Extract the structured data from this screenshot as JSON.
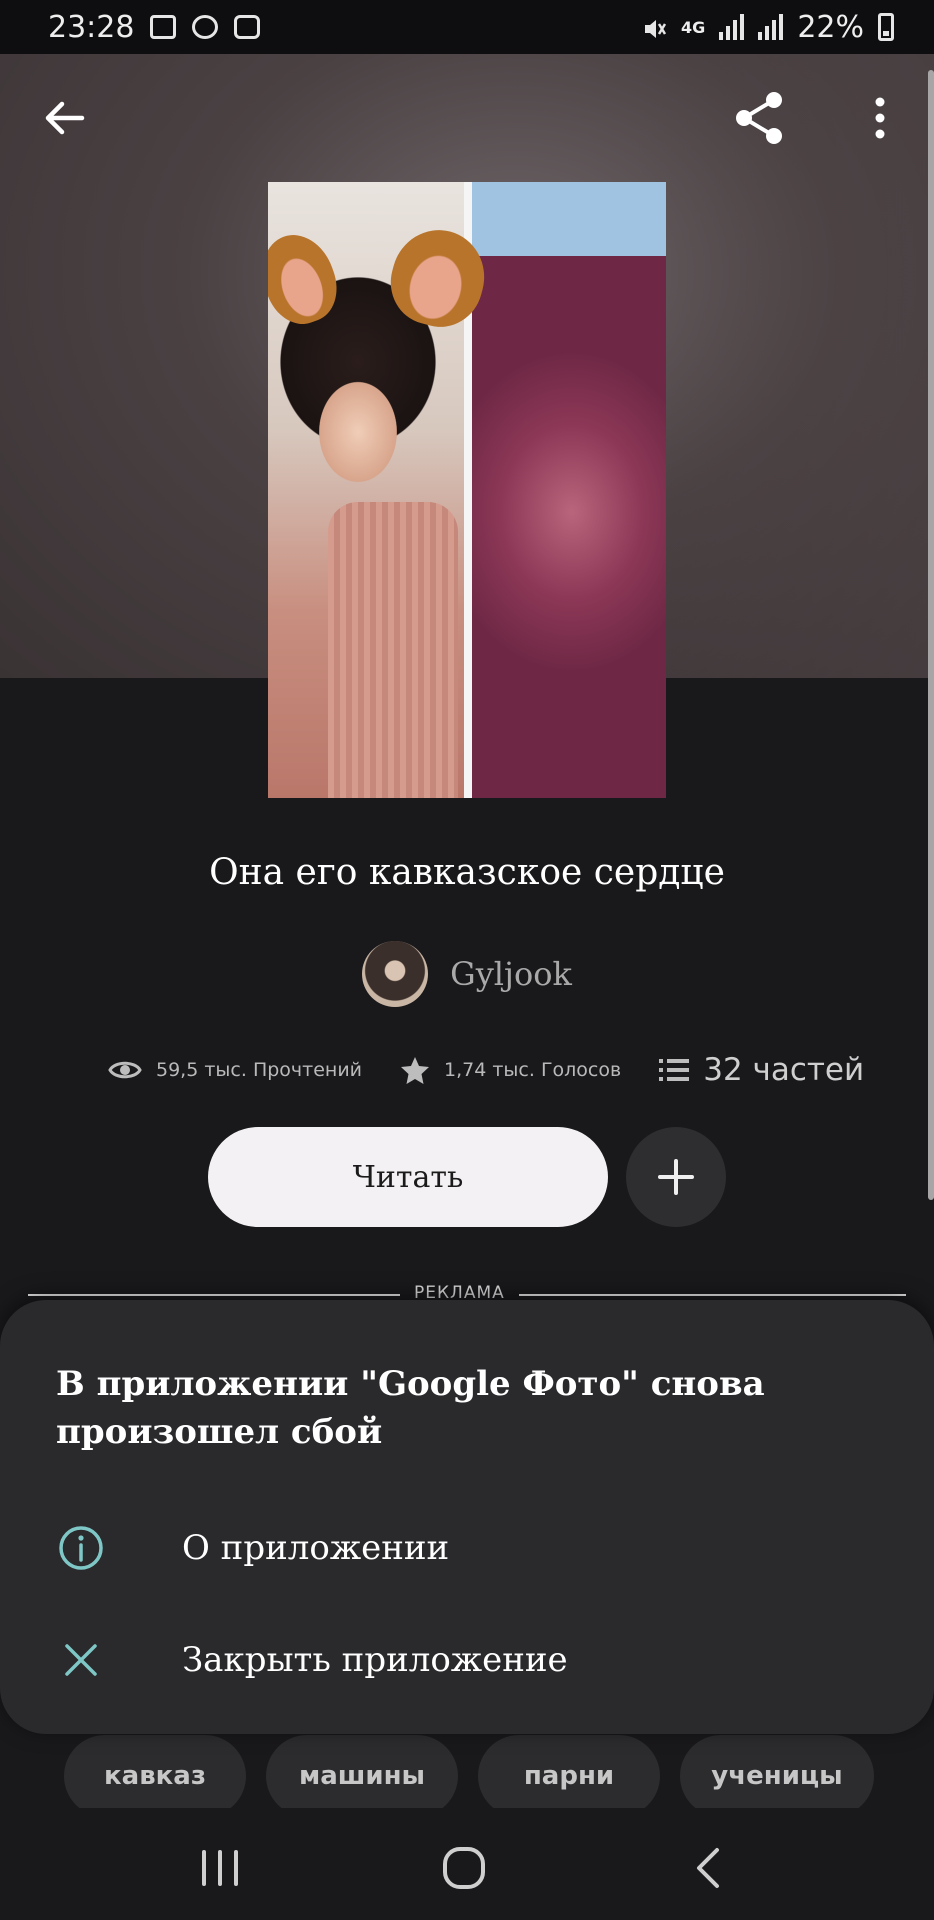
{
  "status_bar": {
    "time": "23:28",
    "network": "4G",
    "battery": "22%",
    "icons": [
      "gallery-icon",
      "download-icon",
      "wifi-icon",
      "mute-icon",
      "signal-icon",
      "signal-icon",
      "battery-charging-icon"
    ]
  },
  "header": {
    "back_icon": "back-arrow-icon",
    "share_icon": "share-icon",
    "more_icon": "more-vert-icon"
  },
  "story": {
    "title": "Она его кавказское сердце",
    "author": "Gyljook",
    "reads": "59,5 тыс. Прочтений",
    "votes": "1,74 тыс. Голосов",
    "parts": "32 частей",
    "read_label": "Читать",
    "add_icon": "plus-icon"
  },
  "ad": {
    "label": "РЕКЛАМА"
  },
  "tags": [
    "кавказ",
    "машины",
    "парни",
    "ученицы"
  ],
  "crash_dialog": {
    "title": "В приложении \"Google Фото\" снова произошел сбой",
    "items": [
      {
        "label": "О приложении",
        "icon": "info-icon"
      },
      {
        "label": "Закрыть приложение",
        "icon": "close-icon"
      }
    ],
    "accent_color": "#7fc7c7"
  },
  "nav_bar": {
    "recents_icon": "recents-icon",
    "home_icon": "home-icon",
    "back_icon": "back-icon"
  }
}
